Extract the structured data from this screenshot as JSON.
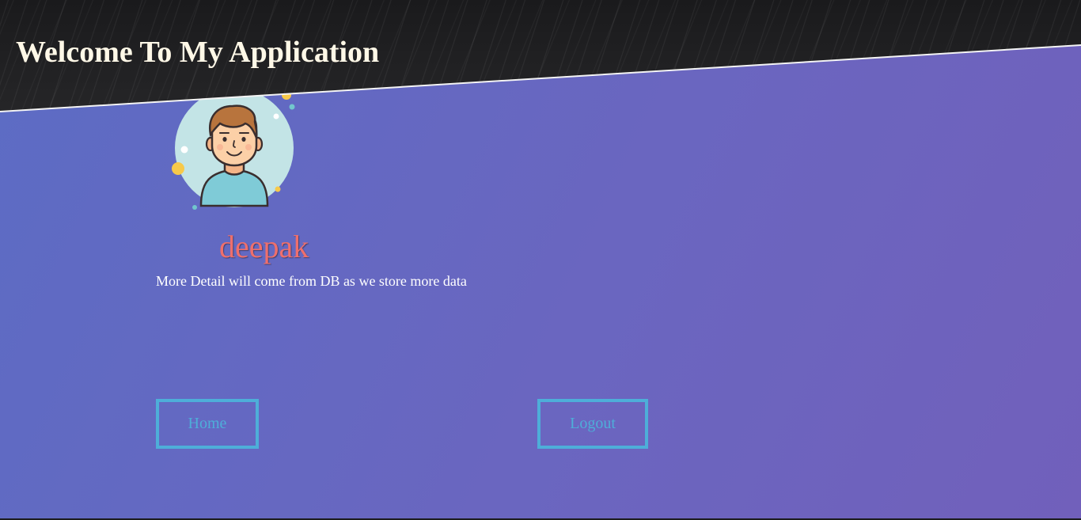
{
  "header": {
    "title": "Welcome To My Application"
  },
  "profile": {
    "username": "deepak",
    "detail": "More Detail will come from DB as we store more data",
    "avatar_icon": "user-avatar-icon"
  },
  "actions": {
    "home_label": "Home",
    "logout_label": "Logout"
  },
  "colors": {
    "header_bg": "#1e1e20",
    "page_gradient_start": "#5c6cc4",
    "page_gradient_end": "#7160bb",
    "title_color": "#fff8e7",
    "username_color": "#ef6f6c",
    "button_accent": "#4eaed9"
  }
}
